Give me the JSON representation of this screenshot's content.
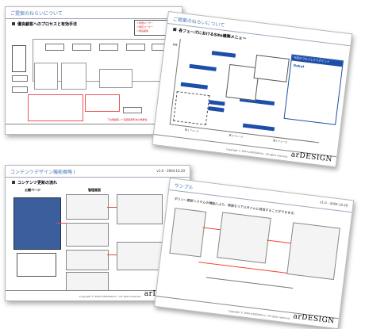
{
  "slides": {
    "s1": {
      "title": "ご提案のねらいについて",
      "subtitle": "優良顧客へのプロセスと有効手法",
      "legend": [
        "＝新規ユーザー",
        "＝既存ユーザー",
        "＝優良顧客"
      ],
      "note": "下位層顧客→一定顧客層形成の重要性"
    },
    "s2": {
      "title": "ご提案のねらいについて",
      "subtitle": "各フェーズにおけるSite構築メニュー",
      "axis_y": "顧客",
      "axis_x": [
        "第１フェーズ",
        "第２フェーズ",
        "第３フェーズ"
      ],
      "legend_title": "今回のプロジェクトポイント",
      "legend_item": "Debut"
    },
    "s3": {
      "title": "コンテンツデザイン機能概略 I",
      "version": "v1.0 - 2004.10.20",
      "subtitle": "コンテンツ更新の流れ",
      "col1": "公開ページ",
      "col2": "管理画面"
    },
    "s4": {
      "title": "サンプル",
      "version": "v1.0 - 2004.10.20",
      "text": "ポリシー更新システムの機能により、情報をリアルタイムに発信することができます。"
    }
  },
  "brand": "arDESIGN",
  "copyright": "Copyright © 2004 arDESIGN Inc. All rights reserved.",
  "colors": {
    "accent": "#1e4fa8",
    "title": "#4a7ab8",
    "alert": "#d22222"
  }
}
